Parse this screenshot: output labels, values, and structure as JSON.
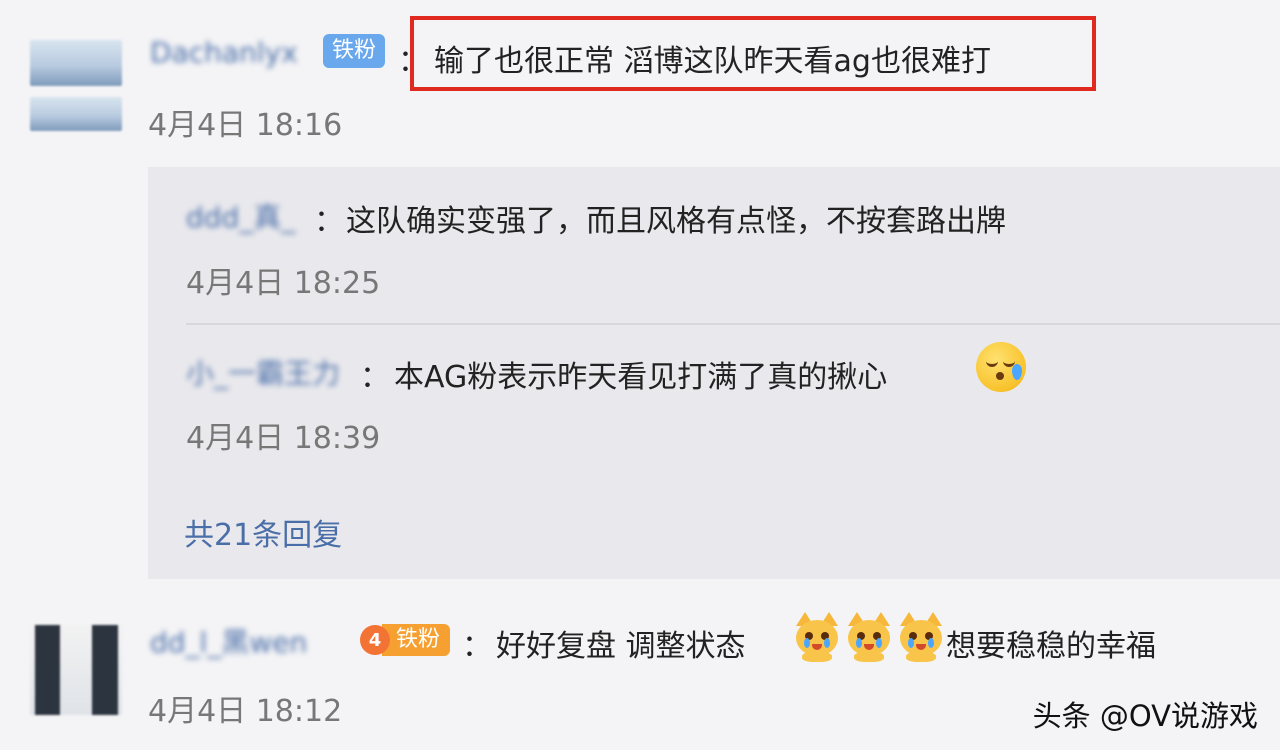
{
  "comments": [
    {
      "username": "Dachanlyx",
      "badge": "铁粉",
      "colon": "：",
      "text": "输了也很正常 滔博这队昨天看ag也很难打",
      "time": "4月4日 18:16"
    },
    {
      "username": "dd_l_黑wen",
      "badge_level": "4",
      "badge": "铁粉",
      "colon": "：",
      "text_parts": [
        "好好复盘 调整状态",
        "想要稳稳的幸福"
      ],
      "emojis": [
        "crying-cat-icon",
        "crying-cat-icon",
        "crying-cat-icon"
      ],
      "time": "4月4日 18:12"
    }
  ],
  "replies": [
    {
      "username": "ddd_真_",
      "colon": "：",
      "text": "这队确实变强了，而且风格有点怪，不按套路出牌",
      "time": "4月4日 18:25"
    },
    {
      "username": "小_一霸王力",
      "colon": "：",
      "text": "本AG粉表示昨天看见打满了真的揪心",
      "emoji": "sleepy-sweat-emoji",
      "time": "4月4日 18:39"
    }
  ],
  "more_replies": "共21条回复",
  "watermark": "头条 @OV说游戏",
  "colors": {
    "highlight": "#e0291f",
    "link": "#4a6ea8",
    "badge": "#6aa8ee",
    "badge_level": "#f7a032"
  }
}
